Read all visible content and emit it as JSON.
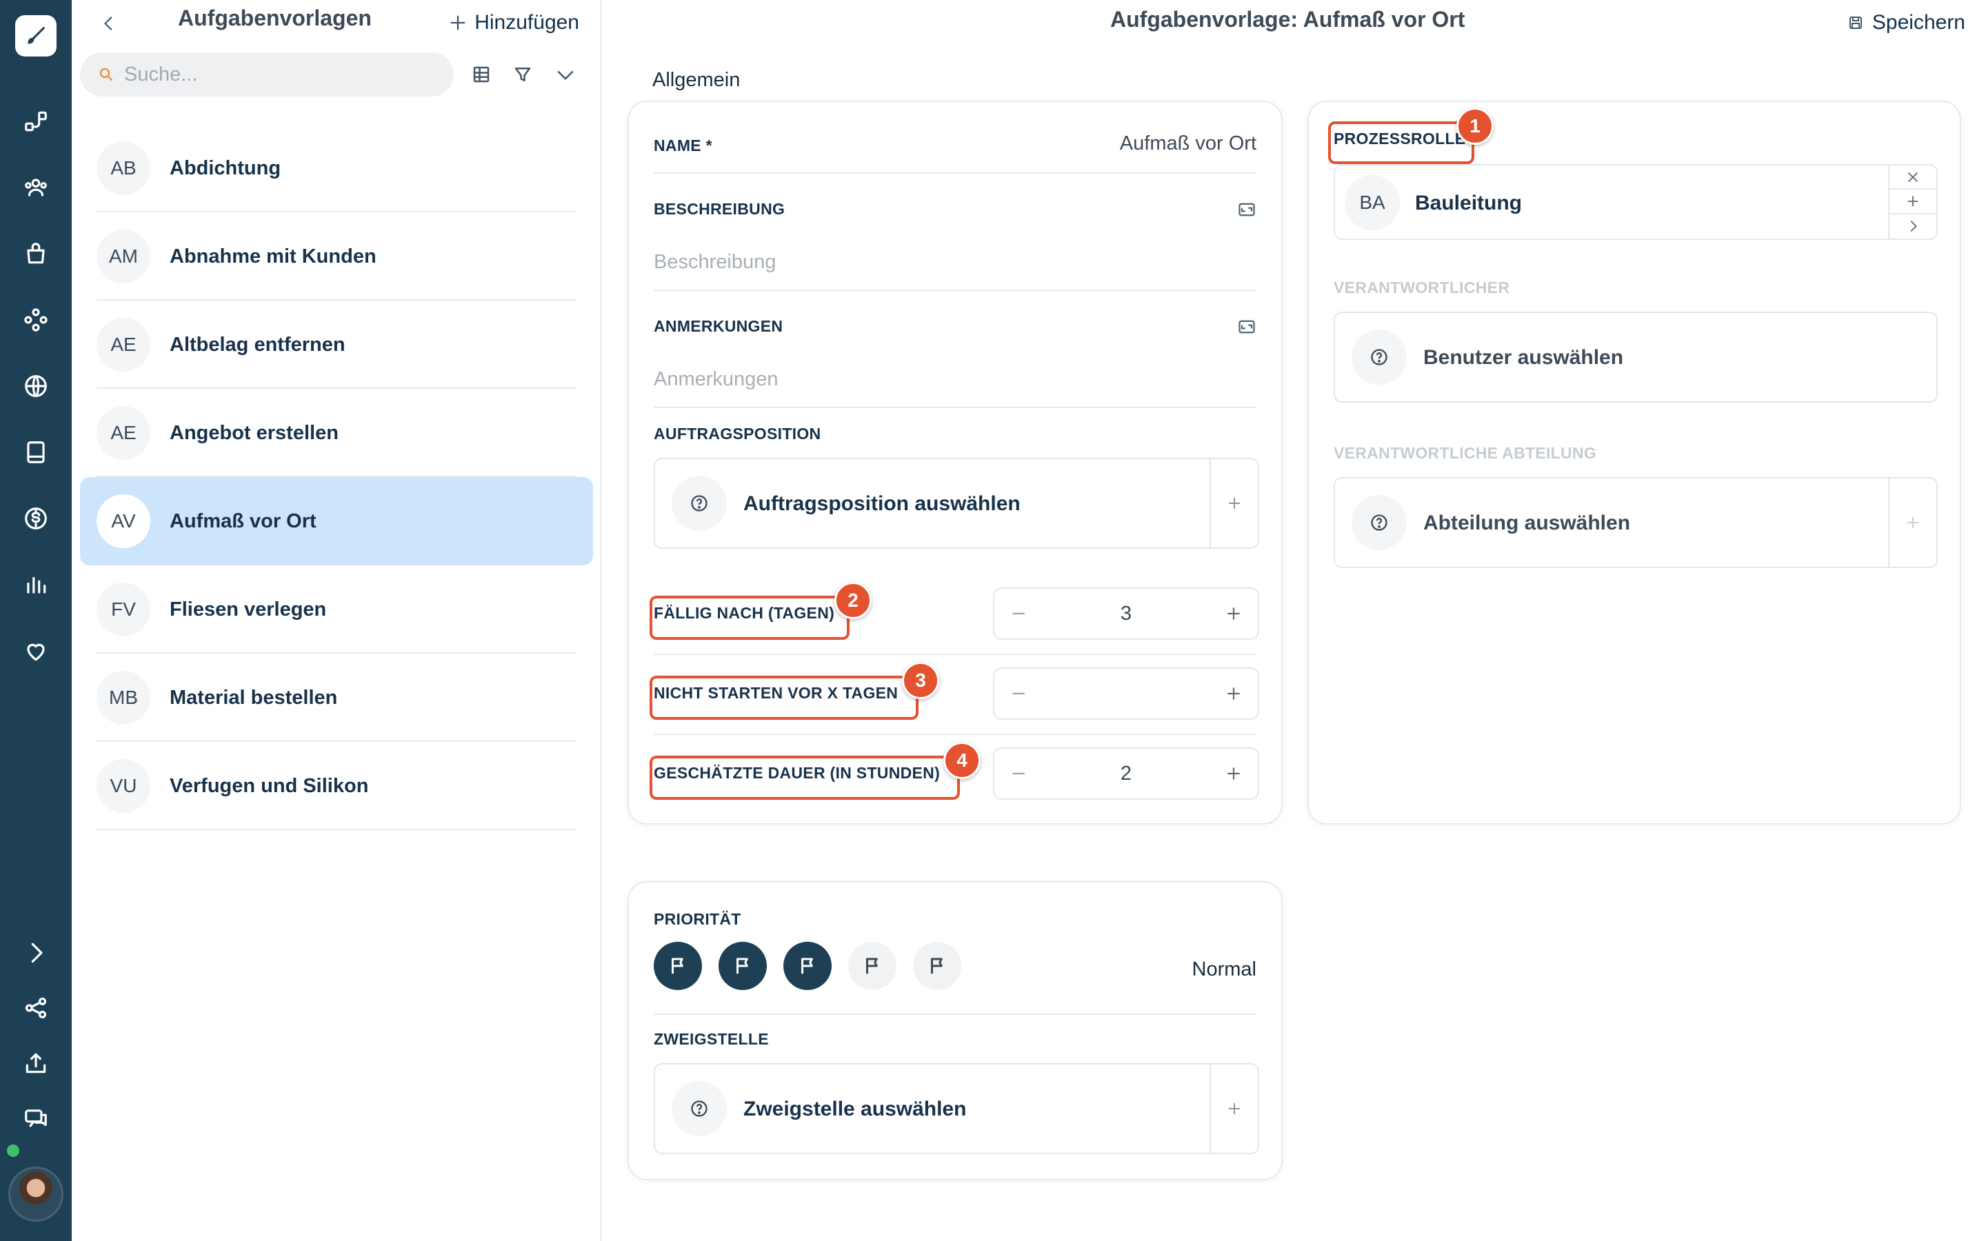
{
  "list": {
    "title": "Aufgabenvorlagen",
    "add_label": "Hinzufügen",
    "search_placeholder": "Suche...",
    "items": [
      {
        "abbr": "AB",
        "name": "Abdichtung"
      },
      {
        "abbr": "AM",
        "name": "Abnahme mit Kunden"
      },
      {
        "abbr": "AE",
        "name": "Altbelag entfernen"
      },
      {
        "abbr": "AE",
        "name": "Angebot erstellen"
      },
      {
        "abbr": "AV",
        "name": "Aufmaß vor Ort",
        "selected": true
      },
      {
        "abbr": "FV",
        "name": "Fliesen verlegen"
      },
      {
        "abbr": "MB",
        "name": "Material bestellen"
      },
      {
        "abbr": "VU",
        "name": "Verfugen und Silikon"
      }
    ]
  },
  "header": {
    "title": "Aufgabenvorlage: Aufmaß vor Ort",
    "save_label": "Speichern"
  },
  "section_tab": "Allgemein",
  "general": {
    "name_label": "NAME *",
    "name_value": "Aufmaß vor Ort",
    "description_label": "BESCHREIBUNG",
    "description_placeholder": "Beschreibung",
    "notes_label": "ANMERKUNGEN",
    "notes_placeholder": "Anmerkungen",
    "order_position_label": "AUFTRAGSPOSITION",
    "order_position_picker": "Auftragsposition auswählen",
    "due_after_label": "FÄLLIG NACH (TAGEN)",
    "due_after_value": "3",
    "not_start_before_label": "NICHT STARTEN VOR X TAGEN",
    "not_start_before_value": "",
    "estimated_duration_label": "GESCHÄTZTE DAUER (IN STUNDEN)",
    "estimated_duration_value": "2"
  },
  "roles": {
    "process_role_label": "PROZESSROLLE",
    "process_role_abbr": "BA",
    "process_role_value": "Bauleitung",
    "responsible_label": "VERANTWORTLICHER",
    "responsible_picker": "Benutzer auswählen",
    "department_label": "VERANTWORTLICHE ABTEILUNG",
    "department_picker": "Abteilung auswählen"
  },
  "priority": {
    "label": "PRIORITÄT",
    "level": 3,
    "max": 5,
    "value_text": "Normal",
    "branch_label": "ZWEIGSTELLE",
    "branch_picker": "Zweigstelle auswählen"
  },
  "annotations": [
    "1",
    "2",
    "3",
    "4"
  ],
  "colors": {
    "rail": "#1e4054",
    "selected_row": "#cde5fb",
    "highlight": "#e4522f"
  }
}
